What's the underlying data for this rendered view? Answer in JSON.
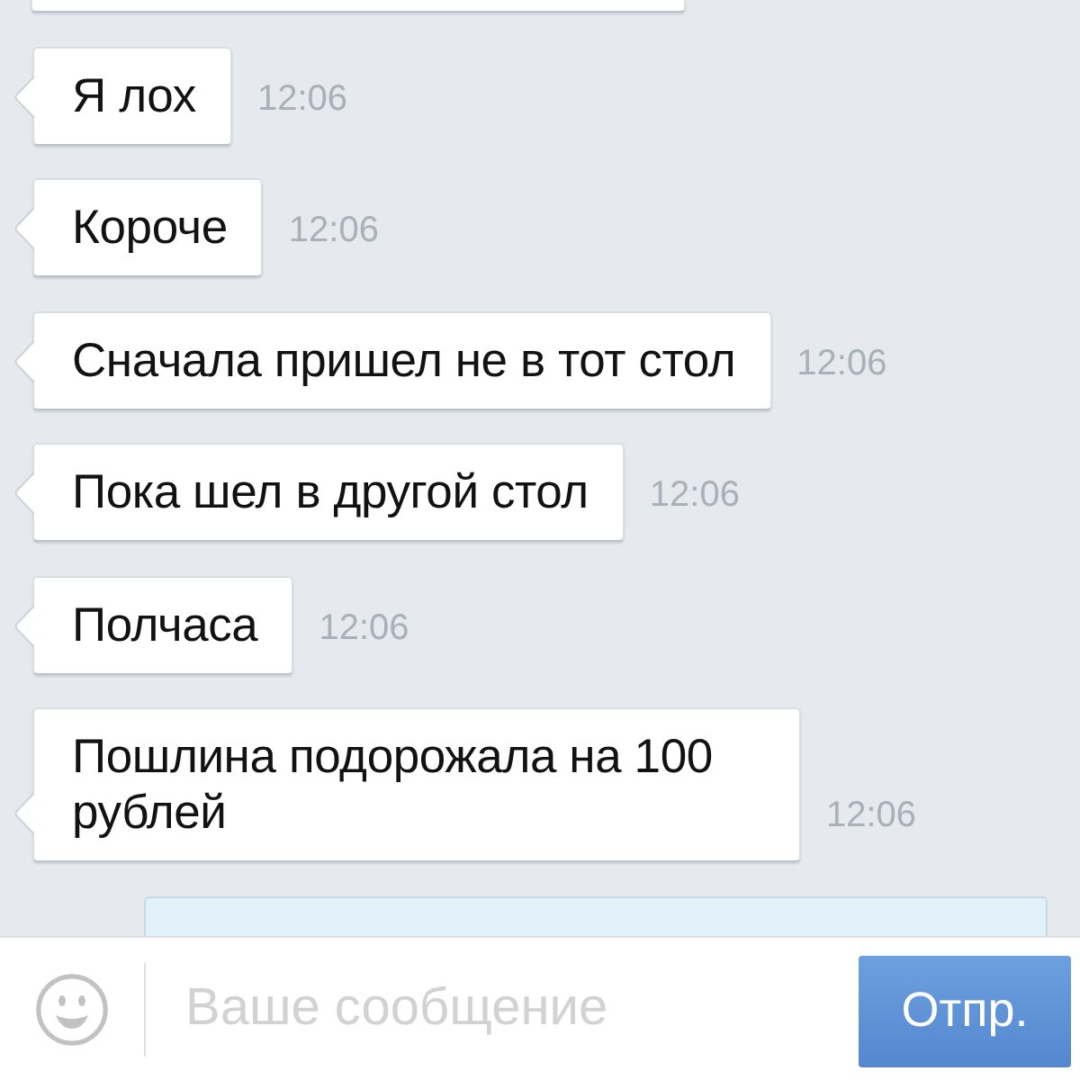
{
  "messages": [
    {
      "kind": "incoming"
    },
    {
      "kind": "incoming",
      "text": "Я лох",
      "time": "12:06"
    },
    {
      "kind": "incoming",
      "text": "Короче",
      "time": "12:06"
    },
    {
      "kind": "incoming",
      "text": "Сначала пришел не в тот стол",
      "time": "12:06"
    },
    {
      "kind": "incoming",
      "text": "Пока шел в другой стол",
      "time": "12:06"
    },
    {
      "kind": "incoming",
      "text": "Полчаса",
      "time": "12:06"
    },
    {
      "kind": "incoming",
      "text": "Пошлина подорожала на 100 рублей",
      "time": "12:06"
    },
    {
      "kind": "outgoing"
    }
  ],
  "composer": {
    "placeholder": "Ваше сообщение",
    "send_button": "Отпр."
  }
}
